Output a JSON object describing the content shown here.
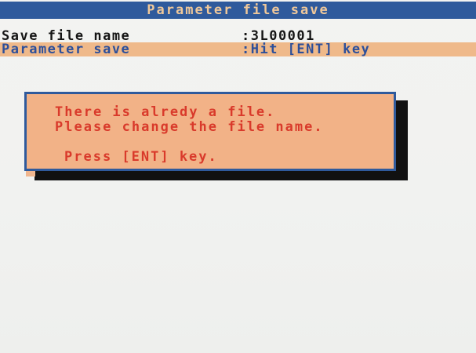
{
  "header": {
    "title": "Parameter file save"
  },
  "fields": [
    {
      "label": "Save file name",
      "value": ":3L00001"
    },
    {
      "label": "Parameter save",
      "value": ":Hit [ENT] key"
    }
  ],
  "dialog": {
    "message_line_1": "There is alredy a file.",
    "message_line_2": "Please change the file name.",
    "prompt": "Press [ENT] key."
  },
  "colors": {
    "title_background": "#2f5a9c",
    "title_text": "#f0c89a",
    "highlight_row": "#efb98a",
    "dialog_background": "#f2b287",
    "dialog_text": "#d93a2b",
    "dialog_border": "#2f5a9c"
  }
}
